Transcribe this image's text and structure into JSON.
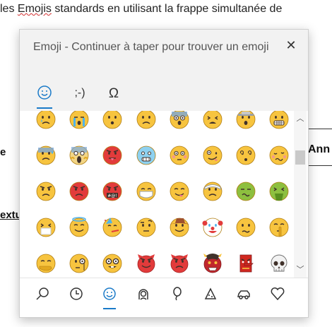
{
  "document": {
    "line_prefix": "les ",
    "line_squiggle_word": "Emojis",
    "line_rest": " standards en utilisant la frappe simultanée de",
    "side_left_1": "e",
    "side_left_2": "extu",
    "side_right": "Ann"
  },
  "panel": {
    "title": "Emoji - Continuer à taper pour trouver un emoji",
    "close_glyph": "✕",
    "tabs": [
      {
        "label": "☺",
        "name": "emoji"
      },
      {
        "label": ";-)",
        "name": "kaomoji"
      },
      {
        "label": "Ω",
        "name": "symbols"
      }
    ],
    "active_tab": "emoji",
    "accent_color": "#1a7ac8",
    "scroll_up_glyph": "︿",
    "scroll_down_glyph": "﹀"
  },
  "emoji_grid": [
    [
      "crying-face",
      "loudly-crying-face",
      "hushed-face",
      "frowning-face",
      "fearful-face",
      "weary-face",
      "face-with-cowboy-hat-lines",
      "grimacing-face"
    ],
    [
      "anxious-face-with-sweat",
      "face-screaming-in-fear",
      "angry-face-tongue",
      "cold-face",
      "flushed-face",
      "zany-face",
      "dizzy-face",
      "woozy-face"
    ],
    [
      "angry-face",
      "pouting-face",
      "face-with-symbols-on-mouth",
      "face-with-medical-mask",
      "face-savoring-food",
      "face-with-head-bandage",
      "nauseated-face",
      "face-vomiting"
    ],
    [
      "sneezing-face",
      "smiling-face-with-halo",
      "partying-face",
      "face-with-raised-eyebrow",
      "cowboy-hat-face",
      "clown-face",
      "confused-face",
      "shushing-face"
    ],
    [
      "face-with-hand-over-mouth",
      "face-with-monocle",
      "nerd-face",
      "smiling-face-with-horns",
      "angry-face-with-horns",
      "ogre",
      "goblin",
      "skull"
    ]
  ],
  "categories": [
    {
      "name": "search",
      "active": false
    },
    {
      "name": "recent",
      "active": false
    },
    {
      "name": "smileys",
      "active": true
    },
    {
      "name": "people",
      "active": false
    },
    {
      "name": "celebrations",
      "active": false
    },
    {
      "name": "food",
      "active": false
    },
    {
      "name": "transport",
      "active": false
    },
    {
      "name": "symbols-heart",
      "active": false
    }
  ]
}
